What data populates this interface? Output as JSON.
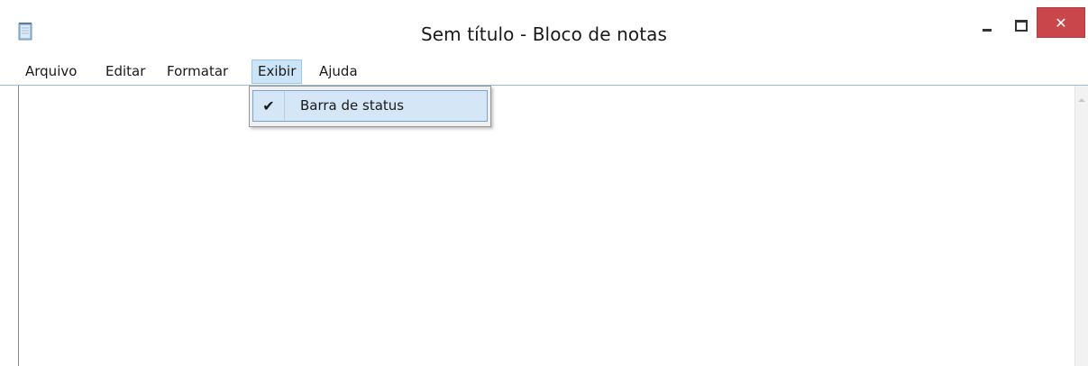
{
  "window": {
    "title": "Sem título - Bloco de notas",
    "icon": "notepad-icon",
    "controls": {
      "minimize": "minimize-icon",
      "maximize": "maximize-icon",
      "close": "✕"
    },
    "close_color": "#c9464b"
  },
  "menubar": {
    "items": [
      {
        "label": "Arquivo"
      },
      {
        "label": "Editar"
      },
      {
        "label": "Formatar"
      },
      {
        "label": "Exibir",
        "active": true
      },
      {
        "label": "Ajuda"
      }
    ],
    "active_color": "#cce4f7"
  },
  "dropdown": {
    "items": [
      {
        "label": "Barra de status",
        "checked": true,
        "check_glyph": "✔"
      }
    ]
  },
  "editor": {
    "content": ""
  }
}
